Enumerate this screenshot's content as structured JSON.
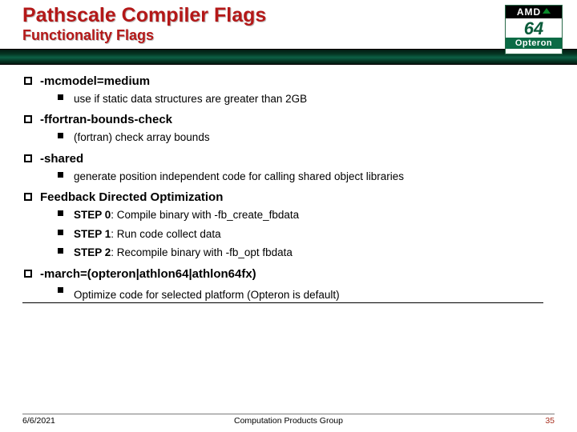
{
  "header": {
    "title": "Pathscale Compiler Flags",
    "subtitle": "Functionality Flags"
  },
  "logo": {
    "brand": "AMD",
    "number": "64",
    "product": "Opteron"
  },
  "items": [
    {
      "label": "-mcmodel=medium",
      "subs": [
        "use if static data structures are greater than 2GB"
      ]
    },
    {
      "label": "-ffortran-bounds-check",
      "subs": [
        "(fortran) check array bounds"
      ]
    },
    {
      "label": "-shared",
      "subs": [
        "generate position independent code for calling shared object libraries"
      ]
    },
    {
      "label": "Feedback Directed Optimization",
      "subs_rich": [
        {
          "bold": "STEP 0",
          "rest": ": Compile binary with -fb_create_fbdata"
        },
        {
          "bold": "STEP 1",
          "rest": ": Run code collect data"
        },
        {
          "bold": "STEP 2",
          "rest": ": Recompile binary with -fb_opt fbdata"
        }
      ]
    },
    {
      "label": "-march=(opteron|athlon64|athlon64fx)",
      "subs": [
        "Optimize code for selected platform (Opteron is default)"
      ],
      "underline_last": true
    }
  ],
  "footer": {
    "date": "6/6/2021",
    "center": "Computation Products Group",
    "page": "35"
  }
}
